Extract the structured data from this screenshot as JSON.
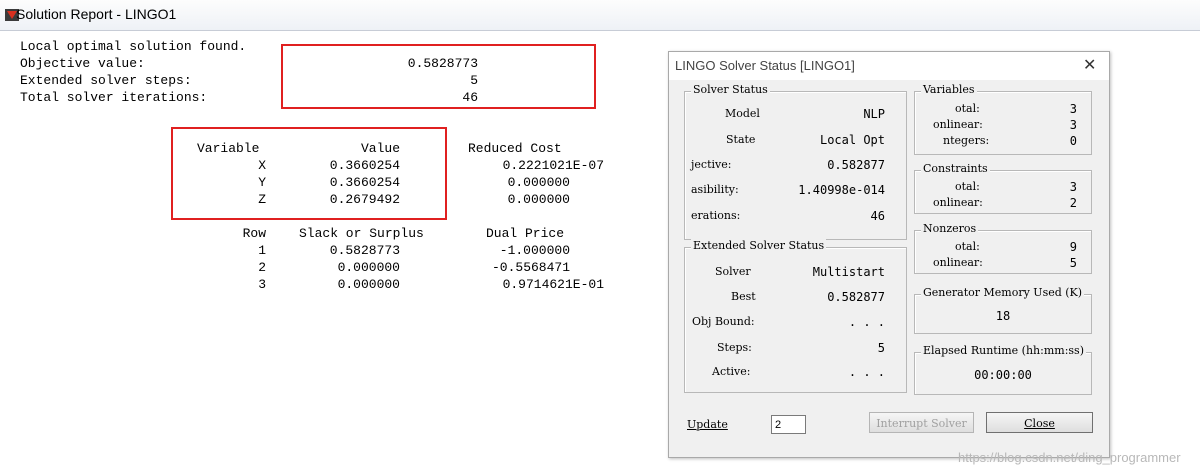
{
  "report": {
    "title": "Solution Report - LINGO1",
    "summary": {
      "line1": "Local optimal solution found.",
      "objective_label": "Objective value:",
      "objective_value": "0.5828773",
      "steps_label": "Extended solver steps:",
      "steps_value": "5",
      "iter_label": "Total solver iterations:",
      "iter_value": "46"
    },
    "var_table": {
      "headers": [
        "Variable",
        "Value",
        "Reduced Cost"
      ],
      "rows": [
        [
          "X",
          "0.3660254",
          "0.2221021E-07"
        ],
        [
          "Y",
          "0.3660254",
          "0.000000"
        ],
        [
          "Z",
          "0.2679492",
          "0.000000"
        ]
      ]
    },
    "row_table": {
      "headers": [
        "Row",
        "Slack or Surplus",
        "Dual Price"
      ],
      "rows": [
        [
          "1",
          "0.5828773",
          "-1.000000"
        ],
        [
          "2",
          "0.000000",
          "-0.5568471"
        ],
        [
          "3",
          "0.000000",
          "0.9714621E-01"
        ]
      ]
    }
  },
  "dialog": {
    "title": "LINGO Solver Status [LINGO1]",
    "solver_status": {
      "label": "Solver Status",
      "model_label": "Model",
      "model_value": "NLP",
      "state_label": "State",
      "state_value": "Local Opt",
      "objective_label": "jective:",
      "objective_value": "0.582877",
      "infeas_label": "asibility:",
      "infeas_value": "1.40998e-014",
      "iter_label": "erations:",
      "iter_value": "46"
    },
    "ext_status": {
      "label": "Extended Solver Status",
      "solver_label": "Solver",
      "solver_value": "Multistart",
      "best_label": "Best",
      "best_value": "0.582877",
      "bound_label": "Obj Bound:",
      "bound_value": ". . .",
      "steps_label": "Steps:",
      "steps_value": "5",
      "active_label": "Active:",
      "active_value": ". . ."
    },
    "variables": {
      "label": "Variables",
      "total_label": "otal:",
      "total_value": "3",
      "nonlinear_label": "onlinear:",
      "nonlinear_value": "3",
      "integers_label": "ntegers:",
      "integers_value": "0"
    },
    "constraints": {
      "label": "Constraints",
      "total_label": "otal:",
      "total_value": "3",
      "nonlinear_label": "onlinear:",
      "nonlinear_value": "2"
    },
    "nonzeros": {
      "label": "Nonzeros",
      "total_label": "otal:",
      "total_value": "9",
      "nonlinear_label": "onlinear:",
      "nonlinear_value": "5"
    },
    "memory": {
      "label": "Generator Memory Used (K)",
      "value": "18"
    },
    "runtime": {
      "label": "Elapsed Runtime (hh:mm:ss)",
      "value": "00:00:00"
    },
    "update_label": "Update",
    "update_value": "2",
    "interrupt_label": "Interrupt Solver",
    "close_label": "Close"
  },
  "watermark": "https://blog.csdn.net/ding_programmer",
  "colors": {
    "highlight_box": "#e02020"
  }
}
